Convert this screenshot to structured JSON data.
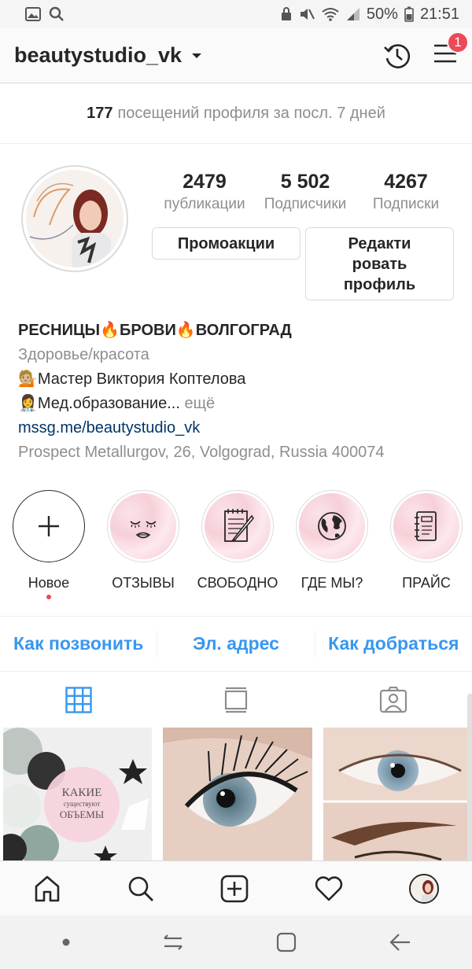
{
  "status_bar": {
    "battery": "50%",
    "time": "21:51"
  },
  "header": {
    "username": "beautystudio_vk",
    "menu_badge": "1"
  },
  "visits": {
    "count": "177",
    "text": "посещений профиля за посл. 7 дней"
  },
  "stats": [
    {
      "value": "2479",
      "label": "публикации"
    },
    {
      "value": "5 502",
      "label": "Подписчики"
    },
    {
      "value": "4267",
      "label": "Подписки"
    }
  ],
  "buttons": {
    "promo": "Промоакции",
    "edit": "Редакти ровать профиль"
  },
  "bio": {
    "name": "РЕСНИЦЫ🔥БРОВИ🔥ВОЛГОГРАД",
    "category": "Здоровье/красота",
    "line1": "💁🏼Мастер Виктория Коптелова",
    "line2": "👩‍⚕️Мед.образование...",
    "more": "ещё",
    "link": "mssg.me/beautystudio_vk",
    "address": "Prospect Metallurgov, 26, Volgograd, Russia 400074"
  },
  "highlights": [
    {
      "label": "Новое",
      "icon": "plus-icon"
    },
    {
      "label": "ОТЗЫВЫ",
      "icon": "face-icon"
    },
    {
      "label": "СВОБОДНО",
      "icon": "notepad-icon"
    },
    {
      "label": "ГДЕ МЫ?",
      "icon": "globe-icon"
    },
    {
      "label": "ПРАЙС",
      "icon": "notebook-icon"
    }
  ],
  "contact": {
    "call": "Как позвонить",
    "email": "Эл. адрес",
    "directions": "Как добраться"
  },
  "posts": [
    {
      "overlay_line1": "КАКИЕ",
      "overlay_line2": "существуют",
      "overlay_line3": "ОБЪЕМЫ"
    }
  ],
  "colors": {
    "accent": "#3897f0",
    "badge": "#ed4956",
    "link": "#003569"
  }
}
